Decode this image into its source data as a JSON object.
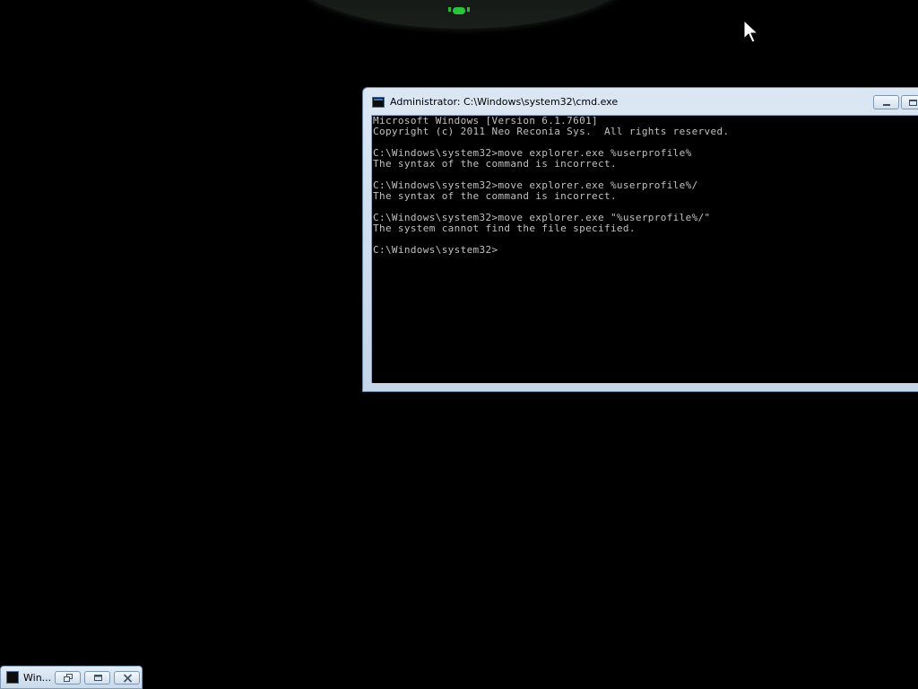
{
  "window": {
    "title": "Administrator: C:\\Windows\\system32\\cmd.exe"
  },
  "console": {
    "lines": [
      "Microsoft Windows [Version 6.1.7601]",
      "Copyright (c) 2011 Neo Reconia Sys.  All rights reserved.",
      "",
      "C:\\Windows\\system32>move explorer.exe %userprofile%",
      "The syntax of the command is incorrect.",
      "",
      "C:\\Windows\\system32>move explorer.exe %userprofile%/",
      "The syntax of the command is incorrect.",
      "",
      "C:\\Windows\\system32>move explorer.exe \"%userprofile%/\"",
      "The system cannot find the file specified.",
      "",
      "C:\\Windows\\system32>"
    ]
  },
  "minimized_window": {
    "label": "Win..."
  },
  "icons": {
    "cmd": "console-icon",
    "restore": "restore-icon",
    "maximize": "maximize-icon",
    "close": "close-icon",
    "minimize": "minimize-icon",
    "cursor": "mouse-pointer-icon"
  },
  "colors": {
    "console_bg": "#000000",
    "console_text": "#c0c0c0",
    "frame": "#c4d6e8",
    "desktop": "#000000"
  }
}
